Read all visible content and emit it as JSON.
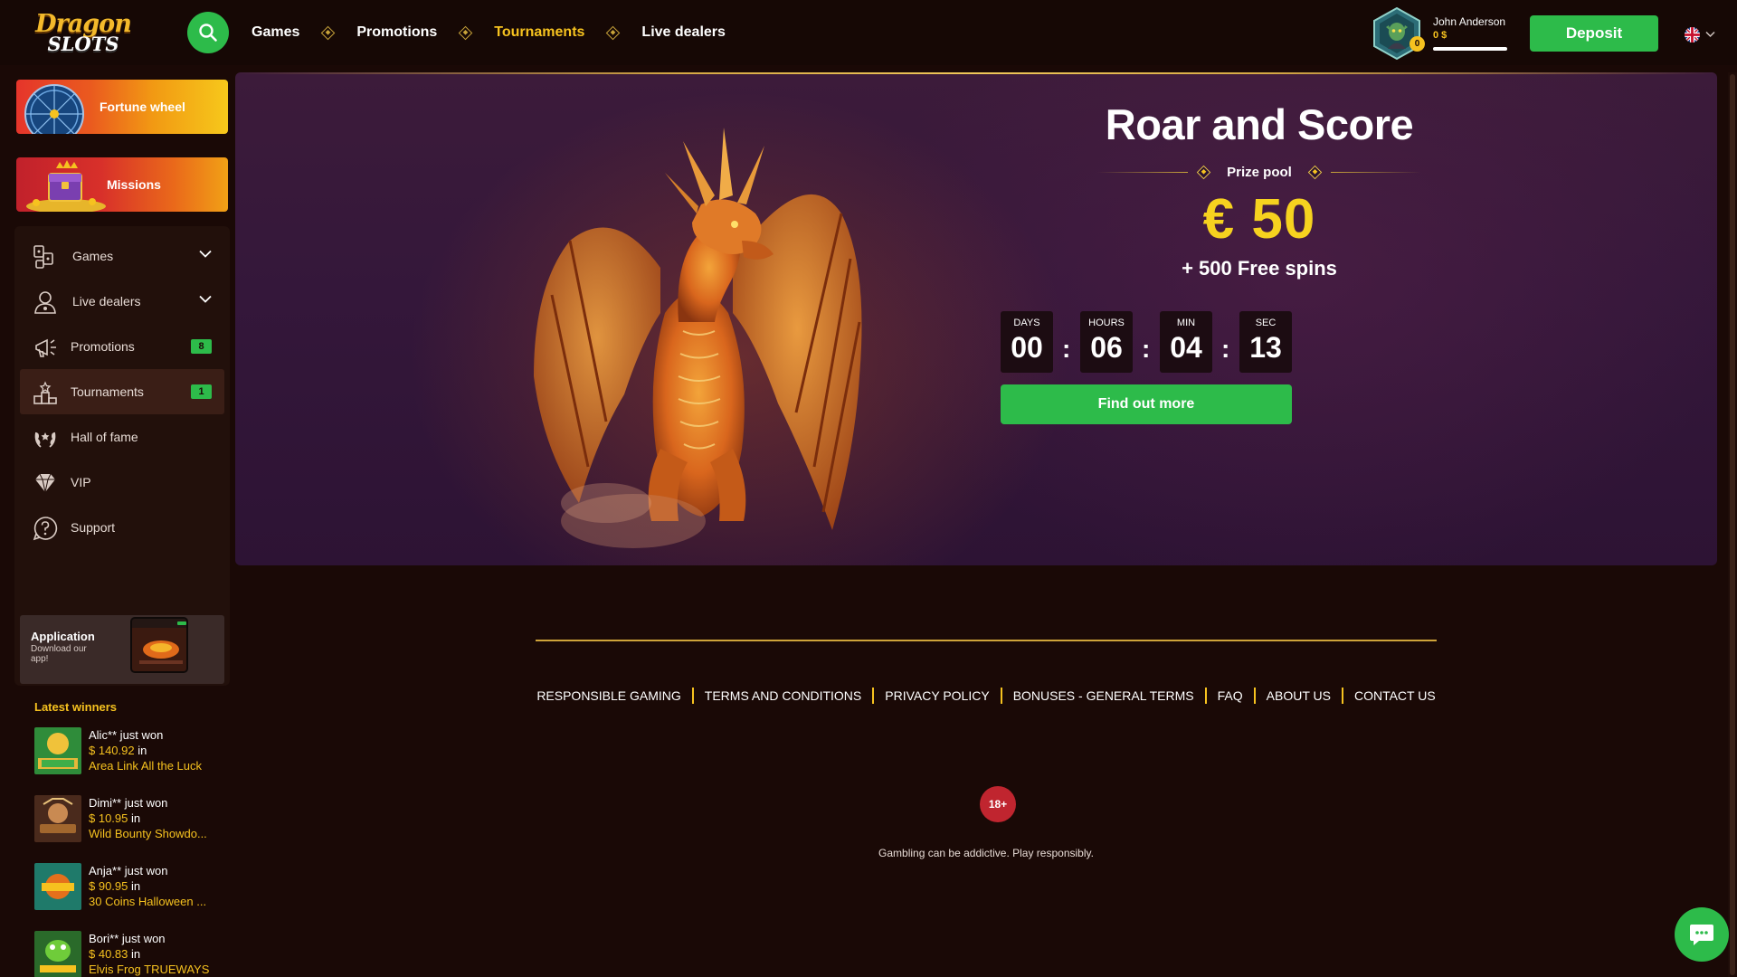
{
  "brand": {
    "logo_line1": "Dragon",
    "logo_line2": "SLOTS"
  },
  "colors": {
    "accent": "#2dbb4a",
    "gold": "#f6c21f",
    "background": "#1a0906",
    "banner": "#34173a"
  },
  "header": {
    "search_icon": "search-icon",
    "nav": [
      {
        "label": "Games",
        "active": false
      },
      {
        "label": "Promotions",
        "active": false
      },
      {
        "label": "Tournaments",
        "active": true
      },
      {
        "label": "Live dealers",
        "active": false
      }
    ],
    "user": {
      "name": "John Anderson",
      "balance": "0 $",
      "level": "0",
      "level_progress": 1.0
    },
    "deposit_label": "Deposit",
    "language_icon": "uk-flag-icon"
  },
  "sidebar": {
    "fortune_wheel": "Fortune wheel",
    "missions": "Missions",
    "menu": [
      {
        "label": "Games",
        "icon": "games-icon",
        "expandable": true
      },
      {
        "label": "Live dealers",
        "icon": "live-dealer-icon",
        "expandable": true
      },
      {
        "label": "Promotions",
        "icon": "megaphone-icon",
        "badge": "8"
      },
      {
        "label": "Tournaments",
        "icon": "podium-icon",
        "badge": "1",
        "active": true
      },
      {
        "label": "Hall of fame",
        "icon": "laurel-icon"
      },
      {
        "label": "VIP",
        "icon": "diamond-icon"
      },
      {
        "label": "Support",
        "icon": "help-icon"
      }
    ],
    "app": {
      "title": "Application",
      "subtitle": "Download our app!"
    },
    "winners_title": "Latest winners",
    "winners": [
      {
        "who": "Alic** just won",
        "amount": "$ 140.92",
        "in": " in",
        "game": "Area Link All the Luck"
      },
      {
        "who": "Dimi** just won",
        "amount": "$ 10.95",
        "in": " in",
        "game": "Wild Bounty Showdo..."
      },
      {
        "who": "Anja** just won",
        "amount": "$ 90.95",
        "in": " in",
        "game": "30 Coins Halloween ..."
      },
      {
        "who": "Bori** just won",
        "amount": "$ 40.83",
        "in": " in",
        "game": "Elvis Frog TRUEWAYS"
      }
    ]
  },
  "banner": {
    "title": "Roar and Score",
    "prize_label": "Prize pool",
    "prize_amount": "€ 50",
    "prize_extra": "+ 500 Free spins",
    "countdown": [
      {
        "label": "DAYS",
        "value": "00"
      },
      {
        "label": "HOURS",
        "value": "06"
      },
      {
        "label": "MIN",
        "value": "04"
      },
      {
        "label": "SEC",
        "value": "13"
      }
    ],
    "colon": ":",
    "cta": "Find out more"
  },
  "footer": {
    "links": [
      "RESPONSIBLE GAMING",
      "TERMS AND CONDITIONS",
      "PRIVACY POLICY",
      "BONUSES - GENERAL TERMS",
      "FAQ",
      "ABOUT US",
      "CONTACT US"
    ],
    "age_badge": "18+",
    "note": "Gambling can be addictive. Play responsibly."
  },
  "chat_icon": "chat-bubble-icon"
}
